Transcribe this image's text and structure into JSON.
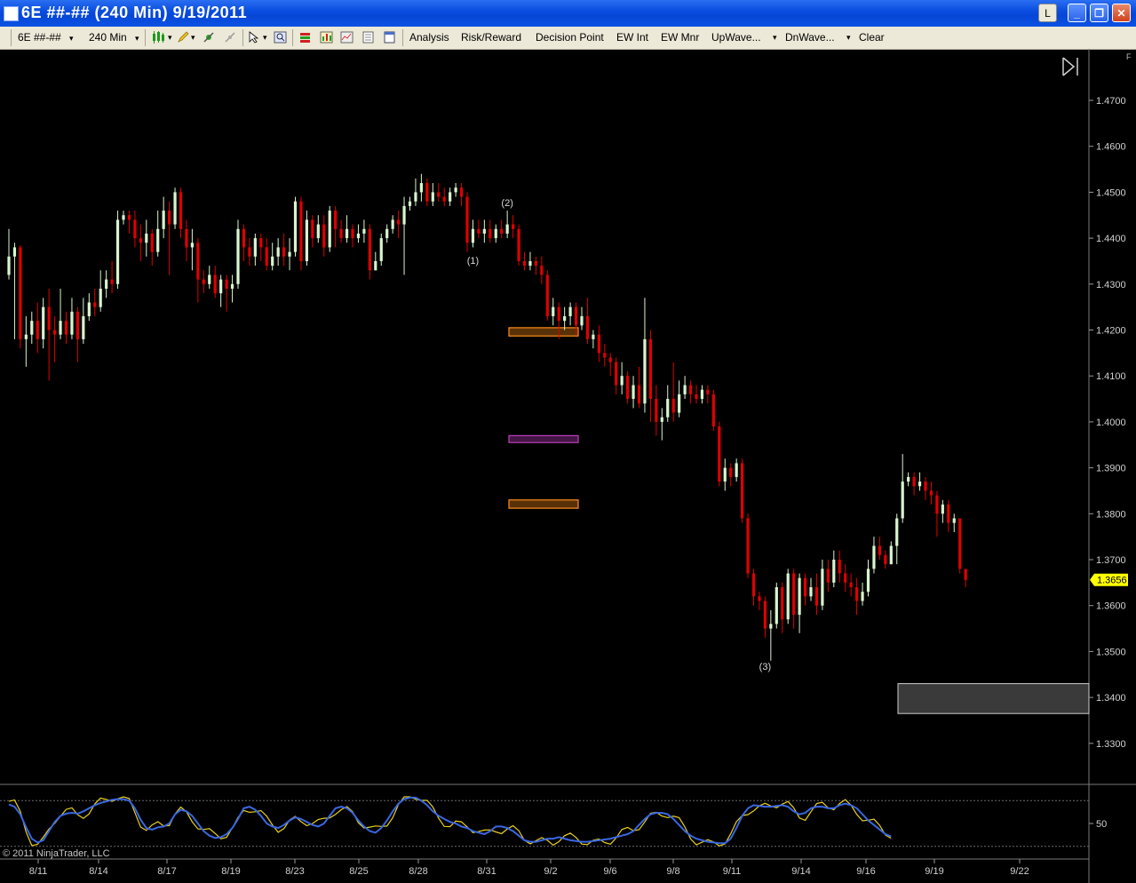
{
  "window": {
    "title": "6E ##-## (240 Min)  9/19/2011",
    "btn_l": "L",
    "btn_min": "_",
    "btn_max": "❐",
    "btn_close": "✕"
  },
  "toolbar": {
    "instrument": "6E ##-##",
    "interval": "240 Min",
    "dropdown_arrow": "▾",
    "analysis": "Analysis",
    "risk_reward": "Risk/Reward",
    "decision_point": "Decision Point",
    "ew_int": "EW Int",
    "ew_mnr": "EW Mnr",
    "upwave": "UpWave...",
    "dnwave": "DnWave...",
    "clear": "Clear"
  },
  "chart": {
    "copyright": "© 2011 NinjaTrader, LLC",
    "price_label": "1.3656",
    "indicator_level_label": "50",
    "wave_labels": [
      "(1)",
      "(2)",
      "(3)"
    ],
    "corner_mark": "F",
    "y_ticks": [
      "1.4700",
      "1.4600",
      "1.4500",
      "1.4400",
      "1.4300",
      "1.4200",
      "1.4100",
      "1.4000",
      "1.3900",
      "1.3800",
      "1.3700",
      "1.3600",
      "1.3500",
      "1.3400",
      "1.3300"
    ],
    "x_ticks": [
      "8/11",
      "8/14",
      "8/17",
      "8/19",
      "8/23",
      "8/25",
      "8/28",
      "8/31",
      "9/2",
      "9/6",
      "9/8",
      "9/11",
      "9/14",
      "9/16",
      "9/19",
      "9/22"
    ],
    "colors": {
      "up": "#d8f5d0",
      "down": "#e00000",
      "stoch_k": "#e8d020",
      "stoch_d": "#3a66e0",
      "price_badge": "#ffff00",
      "zone_orange": "#ff8c1a",
      "zone_purple": "#c040c0"
    }
  },
  "chart_data": {
    "type": "candlestick",
    "title": "",
    "ylim": [
      1.321,
      1.48
    ],
    "y_ticks": [
      1.47,
      1.46,
      1.45,
      1.44,
      1.43,
      1.42,
      1.41,
      1.4,
      1.39,
      1.38,
      1.37,
      1.36,
      1.35,
      1.34,
      1.33
    ],
    "last_price": 1.3656,
    "zones": [
      {
        "color": "orange",
        "low": 1.4187,
        "high": 1.4205
      },
      {
        "color": "purple",
        "low": 1.3955,
        "high": 1.397
      },
      {
        "color": "orange",
        "low": 1.3812,
        "high": 1.383
      },
      {
        "color": "gray",
        "low": 1.3365,
        "high": 1.343
      }
    ],
    "wave_labels": [
      {
        "label": "(1)",
        "bar": 81,
        "price": 1.4352
      },
      {
        "label": "(2)",
        "bar": 87,
        "price": 1.4478
      },
      {
        "label": "(3)",
        "bar": 132,
        "price": 1.3468
      }
    ],
    "candles": [
      [
        1.432,
        1.436,
        1.442,
        1.431
      ],
      [
        1.436,
        1.438,
        1.439,
        1.418
      ],
      [
        1.438,
        1.418,
        1.4385,
        1.416
      ],
      [
        1.418,
        1.419,
        1.423,
        1.412
      ],
      [
        1.419,
        1.422,
        1.424,
        1.417
      ],
      [
        1.422,
        1.418,
        1.426,
        1.415
      ],
      [
        1.418,
        1.425,
        1.427,
        1.416
      ],
      [
        1.425,
        1.42,
        1.429,
        1.409
      ],
      [
        1.42,
        1.419,
        1.423,
        1.413
      ],
      [
        1.419,
        1.422,
        1.429,
        1.418
      ],
      [
        1.422,
        1.419,
        1.424,
        1.417
      ],
      [
        1.419,
        1.424,
        1.427,
        1.418
      ],
      [
        1.424,
        1.418,
        1.425,
        1.413
      ],
      [
        1.418,
        1.423,
        1.427,
        1.417
      ],
      [
        1.423,
        1.426,
        1.428,
        1.422
      ],
      [
        1.426,
        1.425,
        1.429,
        1.423
      ],
      [
        1.425,
        1.429,
        1.433,
        1.424
      ],
      [
        1.429,
        1.431,
        1.433,
        1.427
      ],
      [
        1.431,
        1.43,
        1.435,
        1.428
      ],
      [
        1.43,
        1.444,
        1.446,
        1.429
      ],
      [
        1.444,
        1.445,
        1.446,
        1.443
      ],
      [
        1.445,
        1.444,
        1.446,
        1.441
      ],
      [
        1.444,
        1.44,
        1.446,
        1.438
      ],
      [
        1.44,
        1.439,
        1.443,
        1.435
      ],
      [
        1.439,
        1.441,
        1.444,
        1.436
      ],
      [
        1.441,
        1.437,
        1.442,
        1.434
      ],
      [
        1.437,
        1.442,
        1.446,
        1.436
      ],
      [
        1.442,
        1.446,
        1.449,
        1.44
      ],
      [
        1.446,
        1.443,
        1.448,
        1.432
      ],
      [
        1.443,
        1.45,
        1.451,
        1.442
      ],
      [
        1.45,
        1.442,
        1.451,
        1.44
      ],
      [
        1.442,
        1.438,
        1.444,
        1.435
      ],
      [
        1.438,
        1.439,
        1.442,
        1.433
      ],
      [
        1.439,
        1.431,
        1.44,
        1.426
      ],
      [
        1.431,
        1.43,
        1.433,
        1.428
      ],
      [
        1.43,
        1.432,
        1.434,
        1.429
      ],
      [
        1.432,
        1.428,
        1.434,
        1.427
      ],
      [
        1.428,
        1.431,
        1.432,
        1.425
      ],
      [
        1.431,
        1.429,
        1.432,
        1.424
      ],
      [
        1.429,
        1.43,
        1.432,
        1.426
      ],
      [
        1.43,
        1.442,
        1.444,
        1.429
      ],
      [
        1.442,
        1.438,
        1.443,
        1.435
      ],
      [
        1.438,
        1.436,
        1.44,
        1.434
      ],
      [
        1.436,
        1.44,
        1.441,
        1.434
      ],
      [
        1.44,
        1.438,
        1.441,
        1.435
      ],
      [
        1.438,
        1.434,
        1.44,
        1.433
      ],
      [
        1.434,
        1.436,
        1.439,
        1.433
      ],
      [
        1.436,
        1.438,
        1.44,
        1.434
      ],
      [
        1.438,
        1.436,
        1.441,
        1.434
      ],
      [
        1.436,
        1.437,
        1.44,
        1.433
      ],
      [
        1.437,
        1.448,
        1.449,
        1.436
      ],
      [
        1.448,
        1.435,
        1.449,
        1.433
      ],
      [
        1.435,
        1.444,
        1.446,
        1.434
      ],
      [
        1.444,
        1.44,
        1.445,
        1.438
      ],
      [
        1.44,
        1.443,
        1.445,
        1.439
      ],
      [
        1.443,
        1.438,
        1.445,
        1.436
      ],
      [
        1.438,
        1.446,
        1.447,
        1.437
      ],
      [
        1.446,
        1.442,
        1.447,
        1.438
      ],
      [
        1.442,
        1.44,
        1.444,
        1.439
      ],
      [
        1.44,
        1.442,
        1.445,
        1.439
      ],
      [
        1.442,
        1.44,
        1.443,
        1.438
      ],
      [
        1.44,
        1.441,
        1.443,
        1.439
      ],
      [
        1.441,
        1.442,
        1.444,
        1.439
      ],
      [
        1.442,
        1.433,
        1.443,
        1.431
      ],
      [
        1.433,
        1.435,
        1.437,
        1.433
      ],
      [
        1.435,
        1.44,
        1.441,
        1.434
      ],
      [
        1.44,
        1.442,
        1.443,
        1.439
      ],
      [
        1.442,
        1.444,
        1.445,
        1.441
      ],
      [
        1.444,
        1.443,
        1.446,
        1.44
      ],
      [
        1.443,
        1.447,
        1.449,
        1.432
      ],
      [
        1.447,
        1.448,
        1.449,
        1.446
      ],
      [
        1.448,
        1.45,
        1.453,
        1.447
      ],
      [
        1.45,
        1.452,
        1.454,
        1.448
      ],
      [
        1.452,
        1.448,
        1.453,
        1.447
      ],
      [
        1.448,
        1.45,
        1.452,
        1.447
      ],
      [
        1.45,
        1.449,
        1.452,
        1.448
      ],
      [
        1.449,
        1.448,
        1.451,
        1.447
      ],
      [
        1.448,
        1.45,
        1.451,
        1.447
      ],
      [
        1.45,
        1.451,
        1.452,
        1.449
      ],
      [
        1.451,
        1.449,
        1.452,
        1.447
      ],
      [
        1.449,
        1.439,
        1.45,
        1.437
      ],
      [
        1.439,
        1.442,
        1.444,
        1.438
      ],
      [
        1.442,
        1.441,
        1.444,
        1.44
      ],
      [
        1.441,
        1.442,
        1.444,
        1.439
      ],
      [
        1.442,
        1.44,
        1.444,
        1.439
      ],
      [
        1.44,
        1.442,
        1.443,
        1.439
      ],
      [
        1.442,
        1.441,
        1.444,
        1.44
      ],
      [
        1.441,
        1.443,
        1.446,
        1.44
      ],
      [
        1.443,
        1.442,
        1.445,
        1.44
      ],
      [
        1.442,
        1.435,
        1.443,
        1.434
      ],
      [
        1.435,
        1.434,
        1.437,
        1.433
      ],
      [
        1.434,
        1.435,
        1.437,
        1.433
      ],
      [
        1.435,
        1.434,
        1.436,
        1.432
      ],
      [
        1.434,
        1.432,
        1.436,
        1.43
      ],
      [
        1.432,
        1.423,
        1.433,
        1.422
      ],
      [
        1.423,
        1.425,
        1.427,
        1.421
      ],
      [
        1.425,
        1.422,
        1.426,
        1.418
      ],
      [
        1.422,
        1.423,
        1.425,
        1.42
      ],
      [
        1.423,
        1.425,
        1.426,
        1.421
      ],
      [
        1.425,
        1.421,
        1.426,
        1.419
      ],
      [
        1.421,
        1.423,
        1.425,
        1.42
      ],
      [
        1.423,
        1.418,
        1.427,
        1.417
      ],
      [
        1.418,
        1.419,
        1.42,
        1.416
      ],
      [
        1.419,
        1.415,
        1.421,
        1.413
      ],
      [
        1.415,
        1.414,
        1.417,
        1.412
      ],
      [
        1.414,
        1.413,
        1.415,
        1.41
      ],
      [
        1.413,
        1.408,
        1.414,
        1.406
      ],
      [
        1.408,
        1.41,
        1.413,
        1.406
      ],
      [
        1.41,
        1.405,
        1.411,
        1.404
      ],
      [
        1.405,
        1.408,
        1.41,
        1.403
      ],
      [
        1.408,
        1.404,
        1.412,
        1.403
      ],
      [
        1.404,
        1.418,
        1.427,
        1.402
      ],
      [
        1.418,
        1.405,
        1.42,
        1.4
      ],
      [
        1.405,
        1.4,
        1.408,
        1.397
      ],
      [
        1.4,
        1.401,
        1.403,
        1.396
      ],
      [
        1.401,
        1.405,
        1.408,
        1.4
      ],
      [
        1.405,
        1.402,
        1.413,
        1.4
      ],
      [
        1.402,
        1.406,
        1.409,
        1.401
      ],
      [
        1.406,
        1.408,
        1.41,
        1.405
      ],
      [
        1.408,
        1.406,
        1.409,
        1.404
      ],
      [
        1.406,
        1.405,
        1.408,
        1.404
      ],
      [
        1.405,
        1.407,
        1.408,
        1.404
      ],
      [
        1.407,
        1.406,
        1.408,
        1.404
      ],
      [
        1.406,
        1.399,
        1.407,
        1.398
      ],
      [
        1.399,
        1.387,
        1.4,
        1.386
      ],
      [
        1.387,
        1.39,
        1.392,
        1.385
      ],
      [
        1.39,
        1.388,
        1.391,
        1.386
      ],
      [
        1.388,
        1.391,
        1.392,
        1.387
      ],
      [
        1.391,
        1.379,
        1.392,
        1.378
      ],
      [
        1.379,
        1.367,
        1.38,
        1.366
      ],
      [
        1.367,
        1.362,
        1.368,
        1.36
      ],
      [
        1.362,
        1.361,
        1.363,
        1.359
      ],
      [
        1.361,
        1.355,
        1.362,
        1.353
      ],
      [
        1.355,
        1.356,
        1.359,
        1.348
      ],
      [
        1.356,
        1.364,
        1.365,
        1.355
      ],
      [
        1.364,
        1.357,
        1.365,
        1.354
      ],
      [
        1.357,
        1.367,
        1.368,
        1.356
      ],
      [
        1.367,
        1.358,
        1.368,
        1.355
      ],
      [
        1.358,
        1.366,
        1.367,
        1.354
      ],
      [
        1.366,
        1.362,
        1.367,
        1.36
      ],
      [
        1.362,
        1.364,
        1.366,
        1.361
      ],
      [
        1.364,
        1.36,
        1.367,
        1.358
      ],
      [
        1.36,
        1.368,
        1.37,
        1.359
      ],
      [
        1.368,
        1.365,
        1.37,
        1.363
      ],
      [
        1.365,
        1.37,
        1.372,
        1.364
      ],
      [
        1.37,
        1.367,
        1.372,
        1.365
      ],
      [
        1.367,
        1.365,
        1.369,
        1.363
      ],
      [
        1.365,
        1.364,
        1.367,
        1.362
      ],
      [
        1.364,
        1.361,
        1.366,
        1.358
      ],
      [
        1.361,
        1.363,
        1.365,
        1.36
      ],
      [
        1.363,
        1.368,
        1.37,
        1.362
      ],
      [
        1.368,
        1.373,
        1.375,
        1.367
      ],
      [
        1.373,
        1.371,
        1.375,
        1.37
      ],
      [
        1.371,
        1.369,
        1.372,
        1.368
      ],
      [
        1.369,
        1.373,
        1.374,
        1.369
      ],
      [
        1.373,
        1.379,
        1.38,
        1.369
      ],
      [
        1.379,
        1.387,
        1.393,
        1.378
      ],
      [
        1.387,
        1.388,
        1.389,
        1.386
      ],
      [
        1.388,
        1.386,
        1.389,
        1.384
      ],
      [
        1.386,
        1.387,
        1.389,
        1.385
      ],
      [
        1.387,
        1.385,
        1.388,
        1.383
      ],
      [
        1.385,
        1.384,
        1.387,
        1.382
      ],
      [
        1.384,
        1.38,
        1.385,
        1.375
      ],
      [
        1.38,
        1.382,
        1.383,
        1.378
      ],
      [
        1.382,
        1.378,
        1.383,
        1.376
      ],
      [
        1.378,
        1.379,
        1.38,
        1.376
      ],
      [
        1.379,
        1.368,
        1.37,
        1.367
      ],
      [
        1.368,
        1.3656,
        1.367,
        1.364
      ]
    ],
    "stochastics": {
      "reference_levels": [
        20,
        80
      ],
      "d_line": [
        75,
        72,
        62,
        45,
        30,
        25,
        28,
        40,
        52,
        60,
        63,
        64,
        63,
        66,
        70,
        74,
        77,
        79,
        81,
        82,
        82,
        80,
        70,
        55,
        44,
        42,
        45,
        46,
        50,
        62,
        68,
        66,
        60,
        50,
        40,
        34,
        31,
        32,
        36,
        44,
        56,
        70,
        72,
        68,
        60,
        50,
        46,
        44,
        48,
        54,
        58,
        56,
        52,
        48,
        46,
        50,
        60,
        70,
        72,
        70,
        64,
        54,
        46,
        40,
        38,
        44,
        54,
        66,
        76,
        82,
        84,
        84,
        80,
        74,
        66,
        60,
        56,
        52,
        50,
        46,
        44,
        40,
        38,
        36,
        40,
        46,
        46,
        44,
        40,
        34,
        28,
        26,
        26,
        28,
        30,
        30,
        32,
        30,
        28,
        27,
        26,
        26,
        27,
        28,
        29,
        30,
        32,
        34,
        36,
        40,
        48,
        56,
        62,
        64,
        64,
        62,
        56,
        48,
        40,
        34,
        30,
        28,
        26,
        25,
        24,
        24,
        30,
        44,
        60,
        70,
        74,
        73,
        72,
        72,
        73,
        74,
        72,
        66,
        62,
        64,
        70,
        72,
        72,
        70,
        70,
        74,
        76,
        74,
        70,
        62,
        54,
        48,
        42,
        36,
        33
      ]
    }
  }
}
